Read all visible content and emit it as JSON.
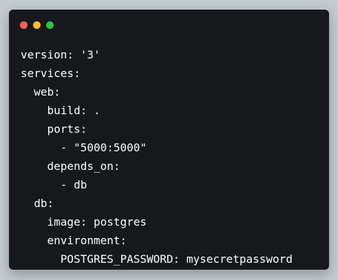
{
  "window": {
    "controls": [
      "close",
      "minimize",
      "maximize"
    ],
    "colors": {
      "background": "#16181c",
      "close": "#ff5f56",
      "minimize": "#ffbd2e",
      "maximize": "#27c93f",
      "text": "#ffffff",
      "page": "#c4cbd1"
    }
  },
  "code": {
    "language": "yaml",
    "lines": [
      "version: '3'",
      "services:",
      "  web:",
      "    build: .",
      "    ports:",
      "      - \"5000:5000\"",
      "    depends_on:",
      "      - db",
      "  db:",
      "    image: postgres",
      "    environment:",
      "      POSTGRES_PASSWORD: mysecretpassword"
    ]
  }
}
